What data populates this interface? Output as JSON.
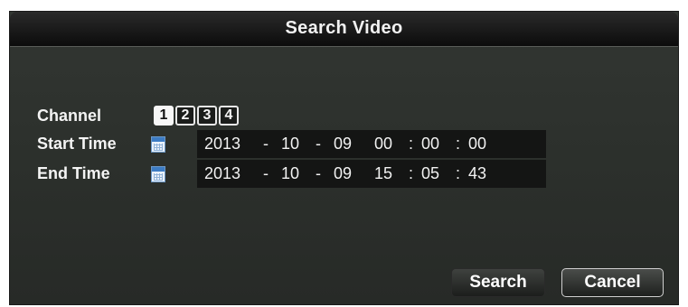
{
  "dialog": {
    "title": "Search Video"
  },
  "channel": {
    "label": "Channel",
    "options": [
      "1",
      "2",
      "3",
      "4"
    ],
    "selected": "1"
  },
  "start_time": {
    "label": "Start Time",
    "year": "2013",
    "month": "10",
    "day": "09",
    "hour": "00",
    "minute": "00",
    "second": "00"
  },
  "end_time": {
    "label": "End Time",
    "year": "2013",
    "month": "10",
    "day": "09",
    "hour": "15",
    "minute": "05",
    "second": "43"
  },
  "separators": {
    "date": "-",
    "time": ":"
  },
  "buttons": {
    "search": "Search",
    "cancel": "Cancel"
  },
  "icons": {
    "calendar": "calendar-icon"
  }
}
